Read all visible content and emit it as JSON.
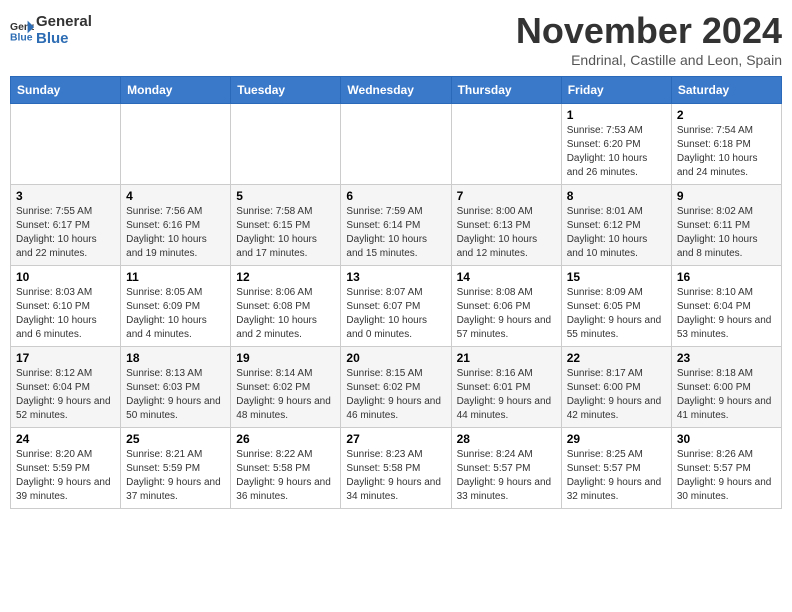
{
  "logo": {
    "line1": "General",
    "line2": "Blue"
  },
  "title": "November 2024",
  "location": "Endrinal, Castille and Leon, Spain",
  "weekdays": [
    "Sunday",
    "Monday",
    "Tuesday",
    "Wednesday",
    "Thursday",
    "Friday",
    "Saturday"
  ],
  "weeks": [
    [
      {
        "day": "",
        "info": ""
      },
      {
        "day": "",
        "info": ""
      },
      {
        "day": "",
        "info": ""
      },
      {
        "day": "",
        "info": ""
      },
      {
        "day": "",
        "info": ""
      },
      {
        "day": "1",
        "info": "Sunrise: 7:53 AM\nSunset: 6:20 PM\nDaylight: 10 hours\nand 26 minutes."
      },
      {
        "day": "2",
        "info": "Sunrise: 7:54 AM\nSunset: 6:18 PM\nDaylight: 10 hours\nand 24 minutes."
      }
    ],
    [
      {
        "day": "3",
        "info": "Sunrise: 7:55 AM\nSunset: 6:17 PM\nDaylight: 10 hours\nand 22 minutes."
      },
      {
        "day": "4",
        "info": "Sunrise: 7:56 AM\nSunset: 6:16 PM\nDaylight: 10 hours\nand 19 minutes."
      },
      {
        "day": "5",
        "info": "Sunrise: 7:58 AM\nSunset: 6:15 PM\nDaylight: 10 hours\nand 17 minutes."
      },
      {
        "day": "6",
        "info": "Sunrise: 7:59 AM\nSunset: 6:14 PM\nDaylight: 10 hours\nand 15 minutes."
      },
      {
        "day": "7",
        "info": "Sunrise: 8:00 AM\nSunset: 6:13 PM\nDaylight: 10 hours\nand 12 minutes."
      },
      {
        "day": "8",
        "info": "Sunrise: 8:01 AM\nSunset: 6:12 PM\nDaylight: 10 hours\nand 10 minutes."
      },
      {
        "day": "9",
        "info": "Sunrise: 8:02 AM\nSunset: 6:11 PM\nDaylight: 10 hours\nand 8 minutes."
      }
    ],
    [
      {
        "day": "10",
        "info": "Sunrise: 8:03 AM\nSunset: 6:10 PM\nDaylight: 10 hours\nand 6 minutes."
      },
      {
        "day": "11",
        "info": "Sunrise: 8:05 AM\nSunset: 6:09 PM\nDaylight: 10 hours\nand 4 minutes."
      },
      {
        "day": "12",
        "info": "Sunrise: 8:06 AM\nSunset: 6:08 PM\nDaylight: 10 hours\nand 2 minutes."
      },
      {
        "day": "13",
        "info": "Sunrise: 8:07 AM\nSunset: 6:07 PM\nDaylight: 10 hours\nand 0 minutes."
      },
      {
        "day": "14",
        "info": "Sunrise: 8:08 AM\nSunset: 6:06 PM\nDaylight: 9 hours\nand 57 minutes."
      },
      {
        "day": "15",
        "info": "Sunrise: 8:09 AM\nSunset: 6:05 PM\nDaylight: 9 hours\nand 55 minutes."
      },
      {
        "day": "16",
        "info": "Sunrise: 8:10 AM\nSunset: 6:04 PM\nDaylight: 9 hours\nand 53 minutes."
      }
    ],
    [
      {
        "day": "17",
        "info": "Sunrise: 8:12 AM\nSunset: 6:04 PM\nDaylight: 9 hours\nand 52 minutes."
      },
      {
        "day": "18",
        "info": "Sunrise: 8:13 AM\nSunset: 6:03 PM\nDaylight: 9 hours\nand 50 minutes."
      },
      {
        "day": "19",
        "info": "Sunrise: 8:14 AM\nSunset: 6:02 PM\nDaylight: 9 hours\nand 48 minutes."
      },
      {
        "day": "20",
        "info": "Sunrise: 8:15 AM\nSunset: 6:02 PM\nDaylight: 9 hours\nand 46 minutes."
      },
      {
        "day": "21",
        "info": "Sunrise: 8:16 AM\nSunset: 6:01 PM\nDaylight: 9 hours\nand 44 minutes."
      },
      {
        "day": "22",
        "info": "Sunrise: 8:17 AM\nSunset: 6:00 PM\nDaylight: 9 hours\nand 42 minutes."
      },
      {
        "day": "23",
        "info": "Sunrise: 8:18 AM\nSunset: 6:00 PM\nDaylight: 9 hours\nand 41 minutes."
      }
    ],
    [
      {
        "day": "24",
        "info": "Sunrise: 8:20 AM\nSunset: 5:59 PM\nDaylight: 9 hours\nand 39 minutes."
      },
      {
        "day": "25",
        "info": "Sunrise: 8:21 AM\nSunset: 5:59 PM\nDaylight: 9 hours\nand 37 minutes."
      },
      {
        "day": "26",
        "info": "Sunrise: 8:22 AM\nSunset: 5:58 PM\nDaylight: 9 hours\nand 36 minutes."
      },
      {
        "day": "27",
        "info": "Sunrise: 8:23 AM\nSunset: 5:58 PM\nDaylight: 9 hours\nand 34 minutes."
      },
      {
        "day": "28",
        "info": "Sunrise: 8:24 AM\nSunset: 5:57 PM\nDaylight: 9 hours\nand 33 minutes."
      },
      {
        "day": "29",
        "info": "Sunrise: 8:25 AM\nSunset: 5:57 PM\nDaylight: 9 hours\nand 32 minutes."
      },
      {
        "day": "30",
        "info": "Sunrise: 8:26 AM\nSunset: 5:57 PM\nDaylight: 9 hours\nand 30 minutes."
      }
    ]
  ]
}
